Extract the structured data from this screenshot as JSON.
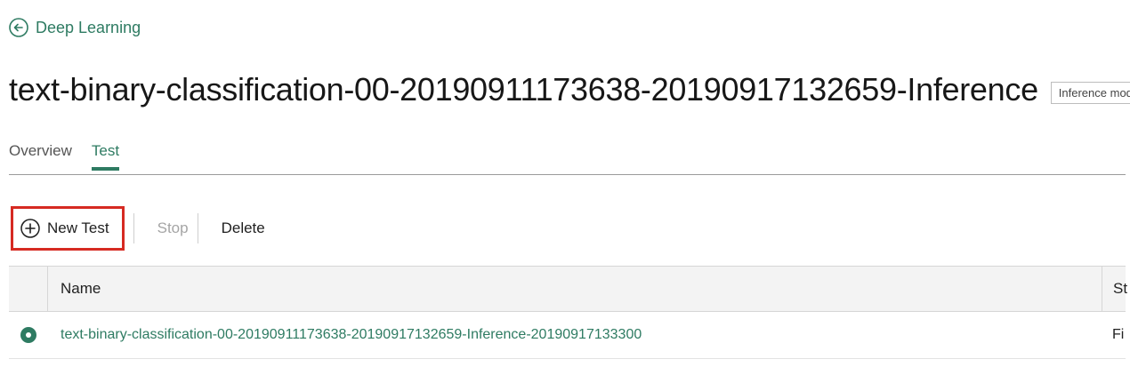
{
  "nav": {
    "back_label": "Deep Learning"
  },
  "header": {
    "title": "text-binary-classification-00-20190911173638-20190917132659-Inference",
    "tag": "Inference model"
  },
  "tabs": [
    {
      "label": "Overview",
      "active": false
    },
    {
      "label": "Test",
      "active": true
    }
  ],
  "toolbar": {
    "new_test_label": "New Test",
    "stop_label": "Stop",
    "delete_label": "Delete"
  },
  "table": {
    "columns": [
      "Name",
      "St"
    ],
    "rows": [
      {
        "name": "text-binary-classification-00-20190911173638-20190917132659-Inference-20190917133300",
        "status": "Fi",
        "selected": true
      }
    ]
  },
  "colors": {
    "accent": "#2e7b62",
    "highlight_border": "#d62a22",
    "disabled": "#a5a5a5"
  }
}
